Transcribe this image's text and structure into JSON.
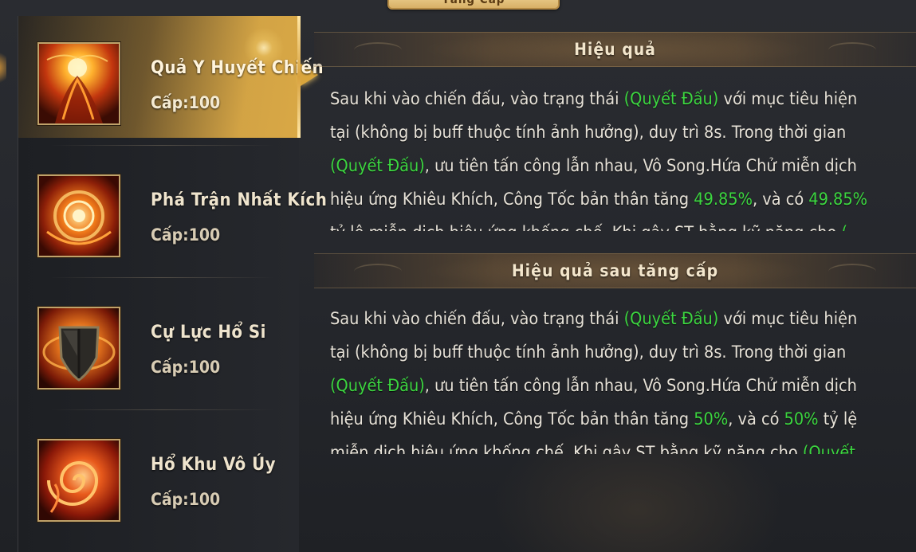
{
  "top_tab": {
    "label": "Tăng Cấp"
  },
  "skills": [
    {
      "name": "Quả Y Huyết Chiến",
      "level": "Cấp:100",
      "icon": "blood-fist-icon",
      "selected": true
    },
    {
      "name": "Phá Trận Nhất Kích",
      "level": "Cấp:100",
      "icon": "vortex-strike-icon",
      "selected": false
    },
    {
      "name": "Cự Lực Hổ Si",
      "level": "Cấp:100",
      "icon": "shield-icon",
      "selected": false
    },
    {
      "name": "Hổ Khu Vô Úy",
      "level": "Cấp:100",
      "icon": "flame-spiral-icon",
      "selected": false
    }
  ],
  "effect": {
    "title": "Hiệu quả",
    "text": [
      "Sau khi vào chiến đấu, vào trạng thái ",
      "(Quyết Đấu)",
      " với mục tiêu hiện tại (không bị buff thuộc tính ảnh hưởng), duy trì 8s. Trong thời gian ",
      "(Quyết Đấu)",
      ", ưu tiên tấn công lẫn nhau, Vô Song.Hứa Chử miễn dịch hiệu ứng Khiêu Khích, Công Tốc bản thân tăng ",
      "49.85%",
      ", và có ",
      "49.85%",
      " tỷ lệ miễn dịch hiệu ứng khống chế. Khi gây ST bằng kỹ năng cho ",
      "("
    ]
  },
  "upgrade_effect": {
    "title": "Hiệu quả sau tăng cấp",
    "text": [
      "Sau khi vào chiến đấu, vào trạng thái ",
      "(Quyết Đấu)",
      " với mục tiêu hiện tại (không bị buff thuộc tính ảnh hưởng), duy trì 8s. Trong thời gian ",
      "(Quyết Đấu)",
      ", ưu tiên tấn công lẫn nhau, Vô Song.Hứa Chử miễn dịch hiệu ứng Khiêu Khích, Công Tốc bản thân tăng ",
      "50%",
      ", và có ",
      "50%",
      " tỷ lệ miễn dịch hiệu ứng khống chế. Khi gây ST bằng kỹ năng cho ",
      "(Quyết"
    ]
  },
  "colors": {
    "highlight": "#3cd640",
    "accent_gold": "#d9a845",
    "text": "#e7e2d8"
  }
}
